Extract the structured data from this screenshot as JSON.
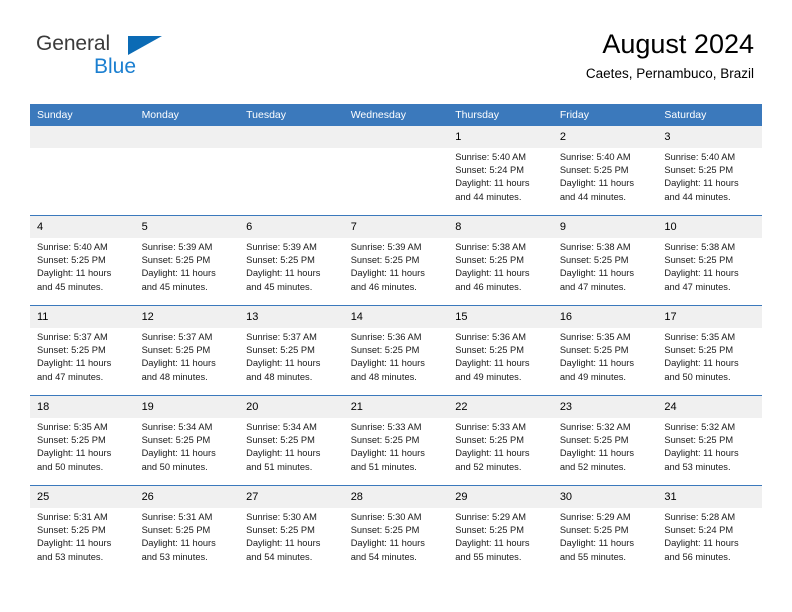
{
  "brand": {
    "name_part1": "General",
    "name_part2": "Blue",
    "triangle_color": "#0b6bb5",
    "blue_color": "#1b7fd0"
  },
  "header": {
    "title": "August 2024",
    "location": "Caetes, Pernambuco, Brazil"
  },
  "theme": {
    "header_blue": "#3b79bc",
    "daynum_background": "#f0f0f0",
    "cell_background": "#ffffff",
    "text_color": "#1a1a1a"
  },
  "weekday_headers": [
    "Sunday",
    "Monday",
    "Tuesday",
    "Wednesday",
    "Thursday",
    "Friday",
    "Saturday"
  ],
  "weeks": [
    [
      {
        "day": "",
        "sunrise": "",
        "sunset": "",
        "daylight_line1": "",
        "daylight_line2": ""
      },
      {
        "day": "",
        "sunrise": "",
        "sunset": "",
        "daylight_line1": "",
        "daylight_line2": ""
      },
      {
        "day": "",
        "sunrise": "",
        "sunset": "",
        "daylight_line1": "",
        "daylight_line2": ""
      },
      {
        "day": "",
        "sunrise": "",
        "sunset": "",
        "daylight_line1": "",
        "daylight_line2": ""
      },
      {
        "day": "1",
        "sunrise": "Sunrise: 5:40 AM",
        "sunset": "Sunset: 5:24 PM",
        "daylight_line1": "Daylight: 11 hours",
        "daylight_line2": "and 44 minutes."
      },
      {
        "day": "2",
        "sunrise": "Sunrise: 5:40 AM",
        "sunset": "Sunset: 5:25 PM",
        "daylight_line1": "Daylight: 11 hours",
        "daylight_line2": "and 44 minutes."
      },
      {
        "day": "3",
        "sunrise": "Sunrise: 5:40 AM",
        "sunset": "Sunset: 5:25 PM",
        "daylight_line1": "Daylight: 11 hours",
        "daylight_line2": "and 44 minutes."
      }
    ],
    [
      {
        "day": "4",
        "sunrise": "Sunrise: 5:40 AM",
        "sunset": "Sunset: 5:25 PM",
        "daylight_line1": "Daylight: 11 hours",
        "daylight_line2": "and 45 minutes."
      },
      {
        "day": "5",
        "sunrise": "Sunrise: 5:39 AM",
        "sunset": "Sunset: 5:25 PM",
        "daylight_line1": "Daylight: 11 hours",
        "daylight_line2": "and 45 minutes."
      },
      {
        "day": "6",
        "sunrise": "Sunrise: 5:39 AM",
        "sunset": "Sunset: 5:25 PM",
        "daylight_line1": "Daylight: 11 hours",
        "daylight_line2": "and 45 minutes."
      },
      {
        "day": "7",
        "sunrise": "Sunrise: 5:39 AM",
        "sunset": "Sunset: 5:25 PM",
        "daylight_line1": "Daylight: 11 hours",
        "daylight_line2": "and 46 minutes."
      },
      {
        "day": "8",
        "sunrise": "Sunrise: 5:38 AM",
        "sunset": "Sunset: 5:25 PM",
        "daylight_line1": "Daylight: 11 hours",
        "daylight_line2": "and 46 minutes."
      },
      {
        "day": "9",
        "sunrise": "Sunrise: 5:38 AM",
        "sunset": "Sunset: 5:25 PM",
        "daylight_line1": "Daylight: 11 hours",
        "daylight_line2": "and 47 minutes."
      },
      {
        "day": "10",
        "sunrise": "Sunrise: 5:38 AM",
        "sunset": "Sunset: 5:25 PM",
        "daylight_line1": "Daylight: 11 hours",
        "daylight_line2": "and 47 minutes."
      }
    ],
    [
      {
        "day": "11",
        "sunrise": "Sunrise: 5:37 AM",
        "sunset": "Sunset: 5:25 PM",
        "daylight_line1": "Daylight: 11 hours",
        "daylight_line2": "and 47 minutes."
      },
      {
        "day": "12",
        "sunrise": "Sunrise: 5:37 AM",
        "sunset": "Sunset: 5:25 PM",
        "daylight_line1": "Daylight: 11 hours",
        "daylight_line2": "and 48 minutes."
      },
      {
        "day": "13",
        "sunrise": "Sunrise: 5:37 AM",
        "sunset": "Sunset: 5:25 PM",
        "daylight_line1": "Daylight: 11 hours",
        "daylight_line2": "and 48 minutes."
      },
      {
        "day": "14",
        "sunrise": "Sunrise: 5:36 AM",
        "sunset": "Sunset: 5:25 PM",
        "daylight_line1": "Daylight: 11 hours",
        "daylight_line2": "and 48 minutes."
      },
      {
        "day": "15",
        "sunrise": "Sunrise: 5:36 AM",
        "sunset": "Sunset: 5:25 PM",
        "daylight_line1": "Daylight: 11 hours",
        "daylight_line2": "and 49 minutes."
      },
      {
        "day": "16",
        "sunrise": "Sunrise: 5:35 AM",
        "sunset": "Sunset: 5:25 PM",
        "daylight_line1": "Daylight: 11 hours",
        "daylight_line2": "and 49 minutes."
      },
      {
        "day": "17",
        "sunrise": "Sunrise: 5:35 AM",
        "sunset": "Sunset: 5:25 PM",
        "daylight_line1": "Daylight: 11 hours",
        "daylight_line2": "and 50 minutes."
      }
    ],
    [
      {
        "day": "18",
        "sunrise": "Sunrise: 5:35 AM",
        "sunset": "Sunset: 5:25 PM",
        "daylight_line1": "Daylight: 11 hours",
        "daylight_line2": "and 50 minutes."
      },
      {
        "day": "19",
        "sunrise": "Sunrise: 5:34 AM",
        "sunset": "Sunset: 5:25 PM",
        "daylight_line1": "Daylight: 11 hours",
        "daylight_line2": "and 50 minutes."
      },
      {
        "day": "20",
        "sunrise": "Sunrise: 5:34 AM",
        "sunset": "Sunset: 5:25 PM",
        "daylight_line1": "Daylight: 11 hours",
        "daylight_line2": "and 51 minutes."
      },
      {
        "day": "21",
        "sunrise": "Sunrise: 5:33 AM",
        "sunset": "Sunset: 5:25 PM",
        "daylight_line1": "Daylight: 11 hours",
        "daylight_line2": "and 51 minutes."
      },
      {
        "day": "22",
        "sunrise": "Sunrise: 5:33 AM",
        "sunset": "Sunset: 5:25 PM",
        "daylight_line1": "Daylight: 11 hours",
        "daylight_line2": "and 52 minutes."
      },
      {
        "day": "23",
        "sunrise": "Sunrise: 5:32 AM",
        "sunset": "Sunset: 5:25 PM",
        "daylight_line1": "Daylight: 11 hours",
        "daylight_line2": "and 52 minutes."
      },
      {
        "day": "24",
        "sunrise": "Sunrise: 5:32 AM",
        "sunset": "Sunset: 5:25 PM",
        "daylight_line1": "Daylight: 11 hours",
        "daylight_line2": "and 53 minutes."
      }
    ],
    [
      {
        "day": "25",
        "sunrise": "Sunrise: 5:31 AM",
        "sunset": "Sunset: 5:25 PM",
        "daylight_line1": "Daylight: 11 hours",
        "daylight_line2": "and 53 minutes."
      },
      {
        "day": "26",
        "sunrise": "Sunrise: 5:31 AM",
        "sunset": "Sunset: 5:25 PM",
        "daylight_line1": "Daylight: 11 hours",
        "daylight_line2": "and 53 minutes."
      },
      {
        "day": "27",
        "sunrise": "Sunrise: 5:30 AM",
        "sunset": "Sunset: 5:25 PM",
        "daylight_line1": "Daylight: 11 hours",
        "daylight_line2": "and 54 minutes."
      },
      {
        "day": "28",
        "sunrise": "Sunrise: 5:30 AM",
        "sunset": "Sunset: 5:25 PM",
        "daylight_line1": "Daylight: 11 hours",
        "daylight_line2": "and 54 minutes."
      },
      {
        "day": "29",
        "sunrise": "Sunrise: 5:29 AM",
        "sunset": "Sunset: 5:25 PM",
        "daylight_line1": "Daylight: 11 hours",
        "daylight_line2": "and 55 minutes."
      },
      {
        "day": "30",
        "sunrise": "Sunrise: 5:29 AM",
        "sunset": "Sunset: 5:25 PM",
        "daylight_line1": "Daylight: 11 hours",
        "daylight_line2": "and 55 minutes."
      },
      {
        "day": "31",
        "sunrise": "Sunrise: 5:28 AM",
        "sunset": "Sunset: 5:24 PM",
        "daylight_line1": "Daylight: 11 hours",
        "daylight_line2": "and 56 minutes."
      }
    ]
  ]
}
